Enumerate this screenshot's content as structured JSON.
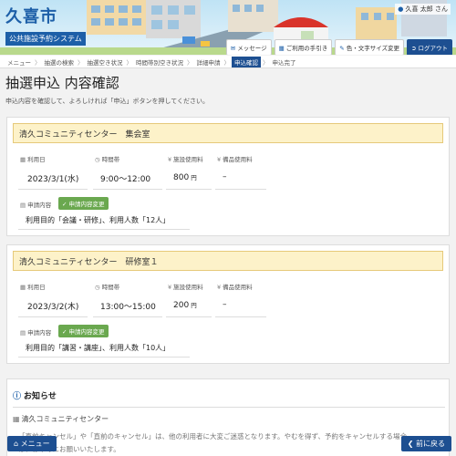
{
  "header": {
    "city_name": "久喜市",
    "system_name": "公共施設予約システム",
    "user_name": "久喜 太郎 さん",
    "buttons": {
      "message": "メッセージ",
      "howto": "ご利用の手引き",
      "display": "色・文字サイズ変更",
      "logout": "ログアウト"
    }
  },
  "breadcrumb": [
    "メニュー",
    "抽選の検索",
    "抽選空き状況",
    "時間帯別空き状況",
    "詳細申請",
    "申込確認",
    "申込完了"
  ],
  "breadcrumb_sep": "〉",
  "page": {
    "title": "抽選申込 内容確認",
    "description": "申込内容を確認して、よろしければ「申込」ボタンを押してください。"
  },
  "labels": {
    "date": "利用日",
    "time": "時間帯",
    "facility_fee": "施設使用料",
    "equipment_fee": "備品使用料",
    "request": "申請内容",
    "change": "申請内容変更",
    "yen": "円"
  },
  "applications": [
    {
      "facility": "清久コミュニティセンター　集会室",
      "date": "2023/3/1(水)",
      "time": "9:00～12:00",
      "fee": "800",
      "equipment": "–",
      "purpose": "利用目的「会議・研修」、利用人数「12人」"
    },
    {
      "facility": "清久コミュニティセンター　研修室１",
      "date": "2023/3/2(木)",
      "time": "13:00～15:00",
      "fee": "200",
      "equipment": "–",
      "purpose": "利用目的「講習・講座」、利用人数「10人」"
    }
  ],
  "notice": {
    "title": "お知らせ",
    "facility": "清久コミュニティセンター",
    "lines": [
      "「直前キャンセル」や「直前のキャンセル」は、他の利用者に大変ご迷惑となります。やむを得ず、予約をキャンセルする場合",
      "は、お早めにお願いいたします。"
    ]
  },
  "footer": {
    "menu": "メニュー",
    "back": "前に戻る"
  },
  "colors": {
    "primary": "#1d4f91",
    "card_head_bg": "#fdf2c9",
    "change_button": "#6aa84f"
  }
}
